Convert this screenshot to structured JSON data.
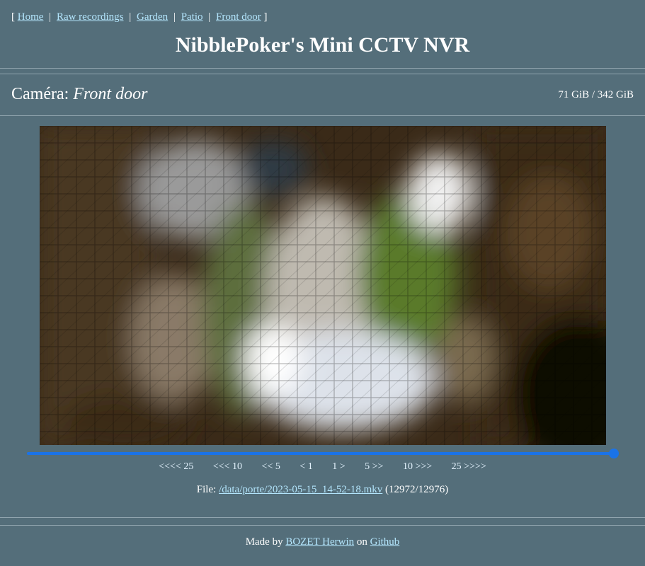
{
  "nav": {
    "open_bracket": "[",
    "close_bracket": "]",
    "separator": "|",
    "items": [
      {
        "label": "Home"
      },
      {
        "label": "Raw recordings"
      },
      {
        "label": "Garden"
      },
      {
        "label": "Patio"
      },
      {
        "label": "Front door"
      }
    ]
  },
  "site": {
    "title": "NibblePoker's Mini CCTV NVR"
  },
  "camera": {
    "prefix": "Caméra:",
    "name": "Front door",
    "storage": "71 GiB / 342 GiB"
  },
  "player": {
    "progress": 0.9997,
    "controls": [
      {
        "label": "<<<< 25"
      },
      {
        "label": "<<< 10"
      },
      {
        "label": "<< 5"
      },
      {
        "label": "< 1"
      },
      {
        "label": "1 >"
      },
      {
        "label": "5 >>"
      },
      {
        "label": "10 >>>"
      },
      {
        "label": "25 >>>>"
      }
    ]
  },
  "file": {
    "prefix": "File:",
    "path": "/data/porte/2023-05-15_14-52-18.mkv",
    "counter": "(12972/12976)"
  },
  "footer": {
    "made_by": "Made by",
    "author": "BOZET Herwin",
    "on": "on",
    "site": "Github"
  },
  "colors": {
    "background": "#546e7a",
    "link": "#b3e5fc",
    "accent": "#1a73e8"
  }
}
